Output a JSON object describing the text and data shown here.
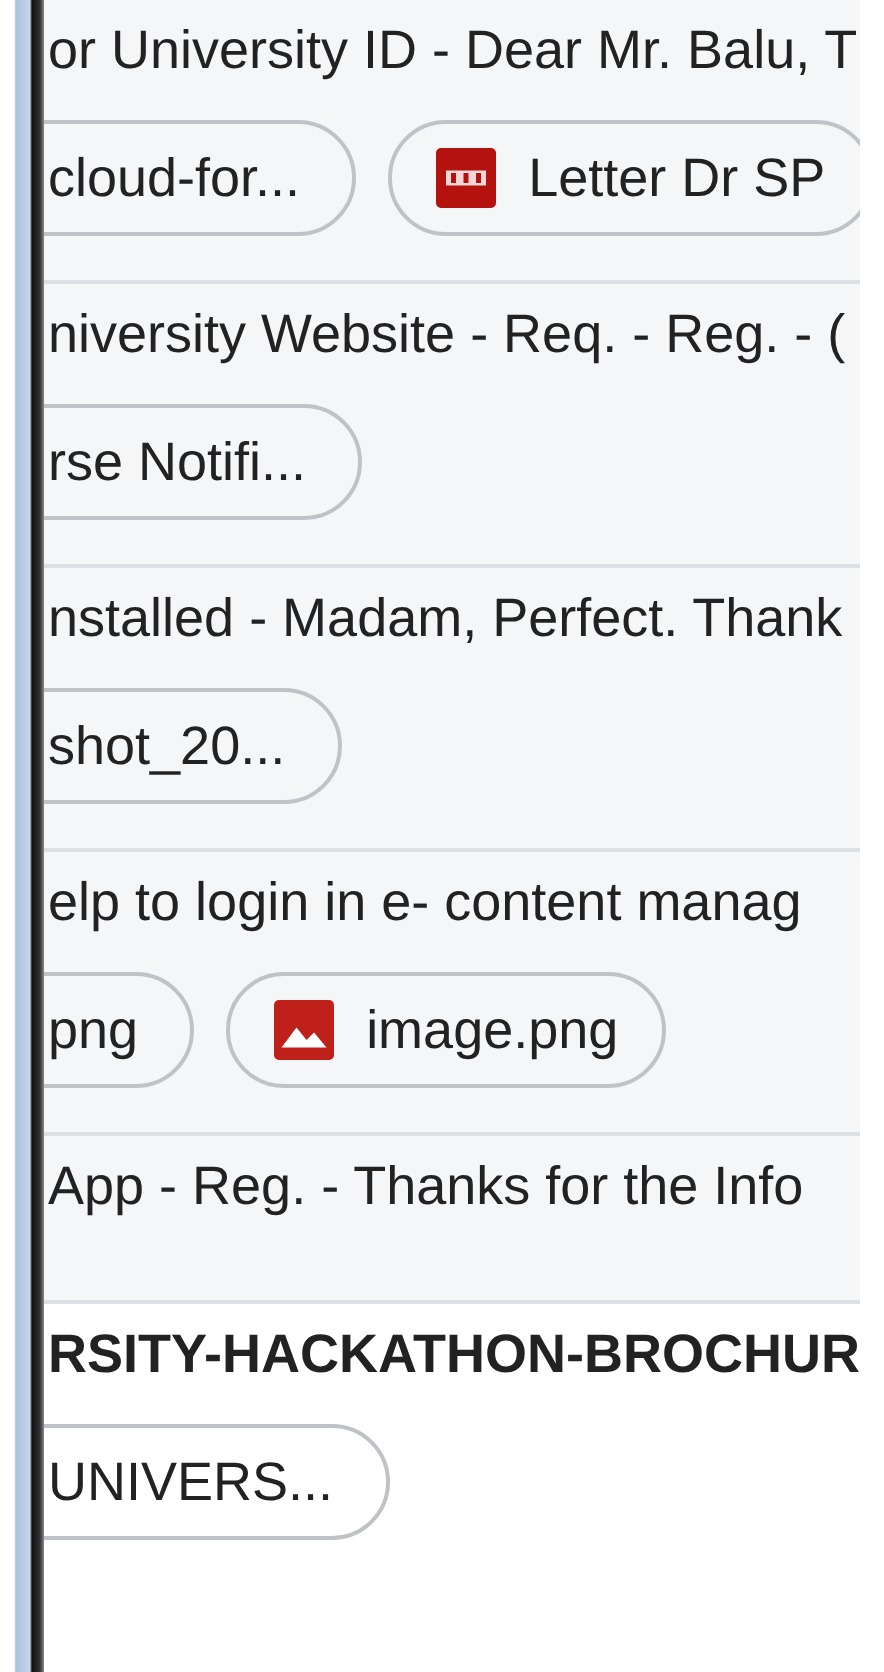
{
  "messages": [
    {
      "snippet": "or University ID - Dear Mr. Balu, T",
      "unread": false,
      "attachments": [
        {
          "name": "cloud-for...",
          "kind": "file"
        },
        {
          "name": "Letter Dr SP",
          "kind": "pdf"
        }
      ]
    },
    {
      "snippet": "niversity Website - Req. - Reg. - (",
      "unread": false,
      "attachments": [
        {
          "name": "rse Notifi...",
          "kind": "file"
        }
      ]
    },
    {
      "snippet": "nstalled - Madam, Perfect. Thank",
      "unread": false,
      "attachments": [
        {
          "name": "shot_20...",
          "kind": "file"
        }
      ]
    },
    {
      "snippet": "elp to login in e- content manag",
      "unread": false,
      "attachments": [
        {
          "name": "png",
          "kind": "file"
        },
        {
          "name": "image.png",
          "kind": "image"
        }
      ]
    },
    {
      "snippet": "App - Reg. - Thanks for the Info",
      "unread": false
    },
    {
      "snippet": "RSITY-HACKATHON-BROCHUR",
      "unread": true,
      "attachments": [
        {
          "name": "UNIVERS...",
          "kind": "file"
        }
      ]
    }
  ]
}
